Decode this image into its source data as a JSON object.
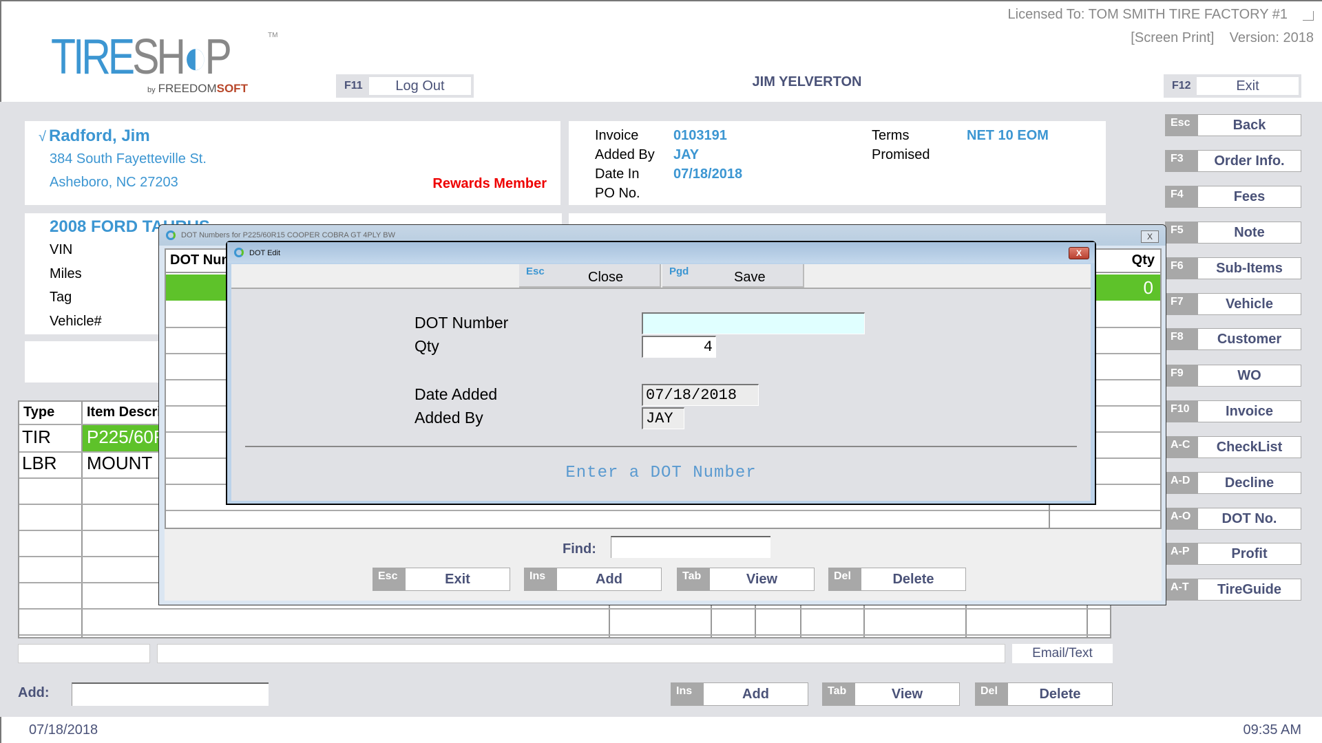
{
  "header": {
    "logo": {
      "main_blue": "TIRE",
      "main_gray": "SH",
      "main_gray2": "P",
      "by": "by",
      "brand_a": "FREEDOM",
      "brand_b": "SOFT",
      "tm": "TM"
    },
    "logout": {
      "key": "F11",
      "label": "Log Out"
    },
    "exit": {
      "key": "F12",
      "label": "Exit"
    },
    "user": "JIM YELVERTON",
    "license": "Licensed To: TOM SMITH TIRE FACTORY #1",
    "version": "[Screen Print]    Version: 2018"
  },
  "customer": {
    "check": "√",
    "name": "Radford, Jim",
    "address1": "384 South Fayetteville St.",
    "address2": "Asheboro, NC  27203",
    "badge": "Rewards Member"
  },
  "invoice": {
    "fields": [
      {
        "label": "Invoice",
        "value": "0103191"
      },
      {
        "label": "Added By",
        "value": "JAY"
      },
      {
        "label": "Date In",
        "value": "07/18/2018"
      },
      {
        "label": "PO No.",
        "value": ""
      }
    ],
    "terms_label": "Terms",
    "terms_value": "NET 10 EOM",
    "promised_label": "Promised",
    "promised_value": ""
  },
  "vehicle": {
    "title": "2008 FORD TAURUS",
    "fields": [
      "VIN",
      "Miles",
      "Tag",
      "Vehicle#"
    ]
  },
  "sidebar": {
    "buttons": [
      {
        "key": "Esc",
        "label": "Back"
      },
      {
        "key": "F3",
        "label": "Order Info."
      },
      {
        "key": "F4",
        "label": "Fees"
      },
      {
        "key": "F5",
        "label": "Note"
      },
      {
        "key": "F6",
        "label": "Sub-Items"
      },
      {
        "key": "F7",
        "label": "Vehicle"
      },
      {
        "key": "F8",
        "label": "Customer"
      },
      {
        "key": "F9",
        "label": "WO"
      },
      {
        "key": "F10",
        "label": "Invoice"
      },
      {
        "key": "A-C",
        "label": "CheckList"
      },
      {
        "key": "A-D",
        "label": "Decline"
      },
      {
        "key": "A-O",
        "label": "DOT No."
      },
      {
        "key": "A-P",
        "label": "Profit"
      },
      {
        "key": "A-T",
        "label": "TireGuide"
      }
    ]
  },
  "items_table": {
    "headers": [
      "Type",
      "Item Descri"
    ],
    "rows": [
      {
        "type": "TIR",
        "desc": "P225/60R"
      },
      {
        "type": "LBR",
        "desc": "MOUNT"
      }
    ]
  },
  "footer": {
    "email_text": "Email/Text",
    "add_label": "Add:",
    "add_value": "",
    "buttons": [
      {
        "key": "Ins",
        "label": "Add"
      },
      {
        "key": "Tab",
        "label": "View"
      },
      {
        "key": "Del",
        "label": "Delete"
      }
    ]
  },
  "statusbar": {
    "date": "07/18/2018",
    "time": "09:35 AM"
  },
  "dot_list_dialog": {
    "title": "DOT Numbers for P225/60R15 COOPER COBRA GT  4PLY BW",
    "close": "X",
    "col_dot": "DOT Number",
    "col_qty": "Qty",
    "selected_qty": "0",
    "find_label": "Find:",
    "find_value": "",
    "buttons": [
      {
        "key": "Esc",
        "label": "Exit"
      },
      {
        "key": "Ins",
        "label": "Add"
      },
      {
        "key": "Tab",
        "label": "View"
      },
      {
        "key": "Del",
        "label": "Delete"
      }
    ]
  },
  "dot_edit_dialog": {
    "title": "DOT Edit",
    "close": "X",
    "toolbar": [
      {
        "key": "Esc",
        "label": "Close"
      },
      {
        "key": "Pgd",
        "label": "Save"
      }
    ],
    "fields": {
      "dot_number_label": "DOT Number",
      "dot_number_value": "",
      "qty_label": "Qty",
      "qty_value": "4",
      "date_added_label": "Date Added",
      "date_added_value": "07/18/2018",
      "added_by_label": "Added By",
      "added_by_value": "JAY"
    },
    "hint": "Enter a DOT Number"
  },
  "colors": {
    "accent_blue": "#3c96d2",
    "selection_green": "#5ec22a",
    "alert_red": "#ee0000",
    "button_text": "#4a5278"
  }
}
